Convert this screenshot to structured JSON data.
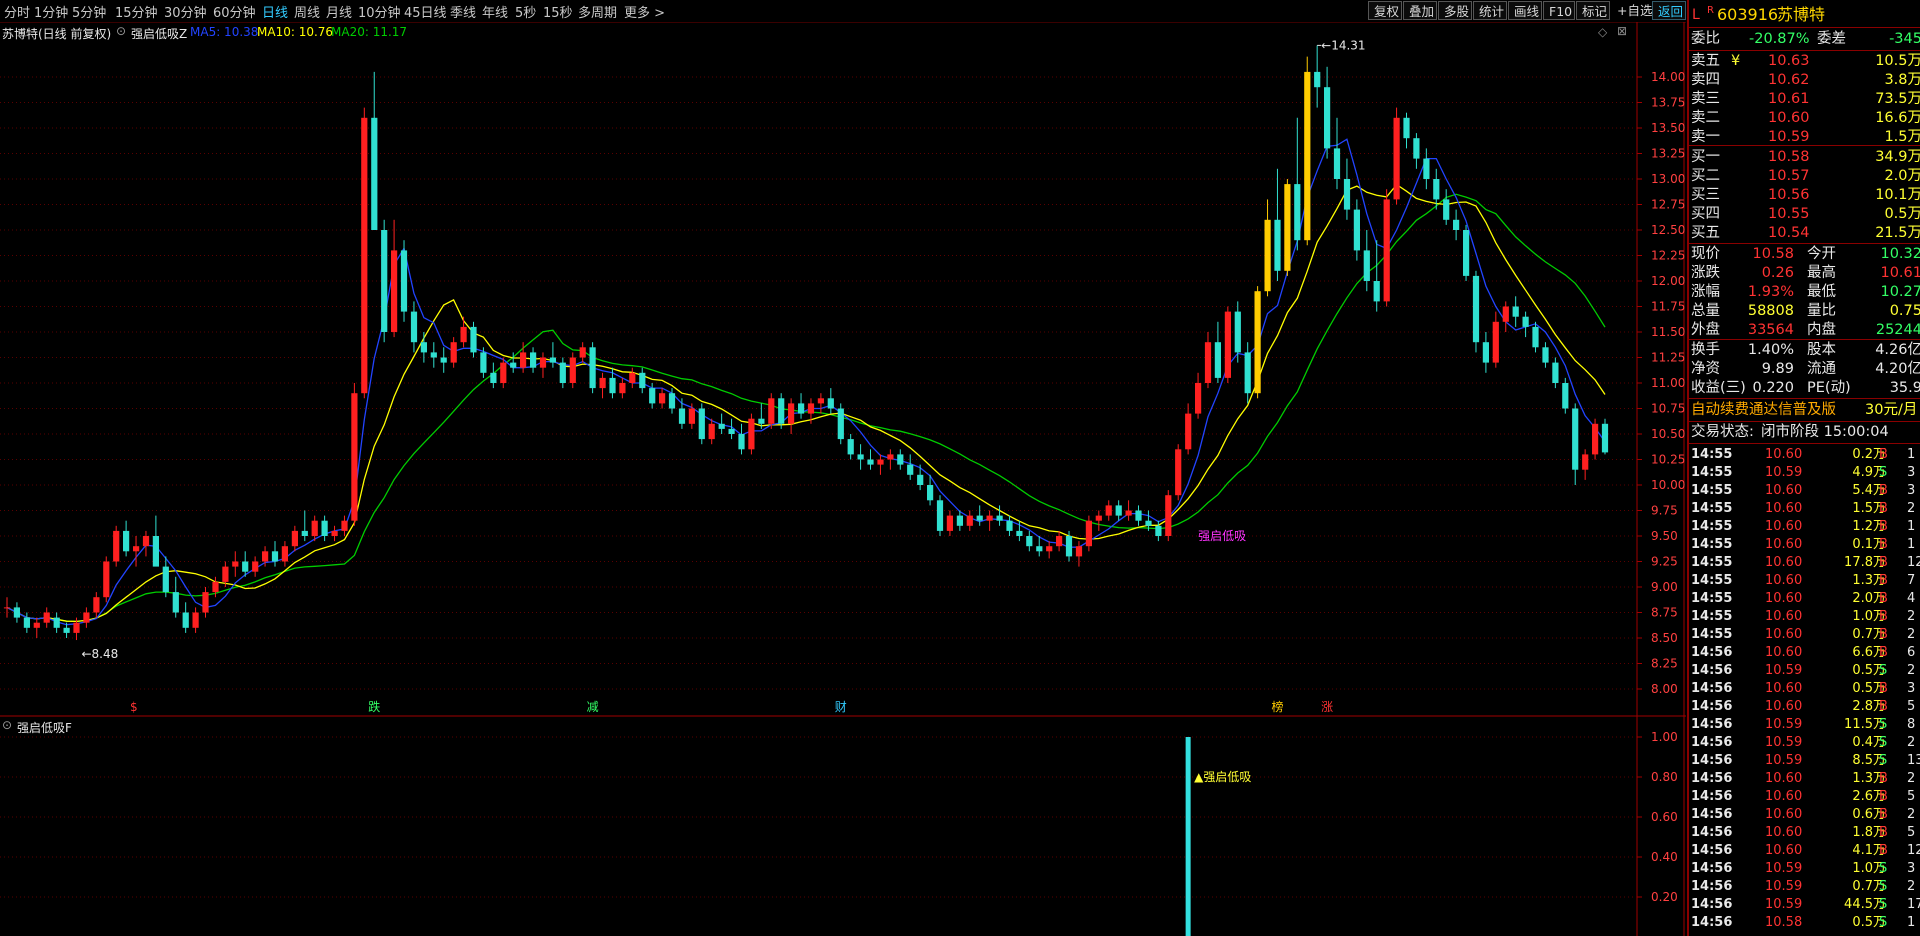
{
  "topbar": {
    "periods": [
      "分时",
      "1分钟",
      "5分钟",
      "15分钟",
      "30分钟",
      "60分钟",
      "日线",
      "周线",
      "月线",
      "10分钟",
      "45日线",
      "季线",
      "年线",
      "5秒",
      "15秒",
      "多周期",
      "更多 >"
    ],
    "active_period": "日线",
    "right_buttons": [
      "复权",
      "叠加",
      "多股",
      "统计",
      "画线",
      "F10",
      "标记",
      "+自选",
      "返回"
    ]
  },
  "chart_info": {
    "stock_desc": "苏博特(日线 前复权)",
    "indicator": "强启低吸Z",
    "ma5_label": "MA5: 10.38",
    "ma10_label": "MA10: 10.76",
    "ma20_label": "MA20: 11.17",
    "ma5_color": "#2244ff",
    "ma10_color": "#ffff00",
    "ma20_color": "#00cc00"
  },
  "sub_panel": {
    "title": "强启低吸F",
    "signal_label": "▲强启低吸"
  },
  "chart_data": {
    "type": "candlestick",
    "price_axis": [
      "14.00",
      "13.75",
      "13.50",
      "13.25",
      "13.00",
      "12.75",
      "12.50",
      "12.25",
      "12.00",
      "11.75",
      "11.50",
      "11.25",
      "11.00",
      "10.75",
      "10.50",
      "10.25",
      "10.00",
      "9.75",
      "9.50",
      "9.25",
      "9.00",
      "8.75",
      "8.50",
      "8.25",
      "8.00"
    ],
    "ylim": [
      7.88,
      14.42
    ],
    "sub_axis": [
      "1.00",
      "0.80",
      "0.60",
      "0.40",
      "0.20"
    ],
    "sub_ylim": [
      0,
      1.05
    ],
    "high_label": "14.31",
    "high_value": 14.31,
    "low_label": "8.48",
    "low_value": 8.48,
    "main_signal_label": "强启低吸",
    "event_markers": [
      {
        "text": "$",
        "color": "#ff3333",
        "idx": 13
      },
      {
        "text": "跌",
        "color": "#33ff66",
        "idx": 37
      },
      {
        "text": "减",
        "color": "#33ff66",
        "idx": 59
      },
      {
        "text": "财",
        "color": "#33ccff",
        "idx": 84
      },
      {
        "text": "榜",
        "color": "#ffcc00",
        "idx": 128
      },
      {
        "text": "涨",
        "color": "#ff3333",
        "idx": 133
      }
    ],
    "signal_idx": 119,
    "signal_value": 1.0,
    "candles": [
      [
        8.8,
        8.9,
        8.7,
        8.8
      ],
      [
        8.8,
        8.85,
        8.65,
        8.7
      ],
      [
        8.7,
        8.75,
        8.55,
        8.6
      ],
      [
        8.6,
        8.7,
        8.5,
        8.65
      ],
      [
        8.65,
        8.8,
        8.6,
        8.75
      ],
      [
        8.7,
        8.75,
        8.55,
        8.6
      ],
      [
        8.6,
        8.65,
        8.5,
        8.55
      ],
      [
        8.55,
        8.7,
        8.48,
        8.65
      ],
      [
        8.65,
        8.8,
        8.6,
        8.75
      ],
      [
        8.75,
        8.95,
        8.7,
        8.9
      ],
      [
        8.9,
        9.3,
        8.85,
        9.25
      ],
      [
        9.25,
        9.6,
        9.2,
        9.55
      ],
      [
        9.55,
        9.65,
        9.3,
        9.35
      ],
      [
        9.35,
        9.5,
        9.2,
        9.4
      ],
      [
        9.4,
        9.55,
        9.3,
        9.5
      ],
      [
        9.5,
        9.7,
        9.3,
        9.2
      ],
      [
        9.2,
        9.3,
        8.9,
        8.95
      ],
      [
        8.95,
        9.1,
        8.7,
        8.75
      ],
      [
        8.75,
        8.85,
        8.55,
        8.6
      ],
      [
        8.6,
        8.8,
        8.55,
        8.75
      ],
      [
        8.75,
        9.0,
        8.7,
        8.95
      ],
      [
        8.95,
        9.1,
        8.9,
        9.05
      ],
      [
        9.05,
        9.25,
        9.0,
        9.2
      ],
      [
        9.2,
        9.35,
        9.1,
        9.25
      ],
      [
        9.25,
        9.35,
        9.1,
        9.15
      ],
      [
        9.15,
        9.3,
        9.1,
        9.25
      ],
      [
        9.25,
        9.4,
        9.2,
        9.35
      ],
      [
        9.35,
        9.45,
        9.2,
        9.25
      ],
      [
        9.25,
        9.45,
        9.2,
        9.4
      ],
      [
        9.4,
        9.6,
        9.35,
        9.55
      ],
      [
        9.55,
        9.75,
        9.45,
        9.5
      ],
      [
        9.5,
        9.7,
        9.45,
        9.65
      ],
      [
        9.65,
        9.7,
        9.45,
        9.5
      ],
      [
        9.5,
        9.6,
        9.45,
        9.55
      ],
      [
        9.55,
        9.7,
        9.5,
        9.65
      ],
      [
        9.65,
        11.0,
        9.6,
        10.9
      ],
      [
        10.9,
        13.7,
        10.85,
        13.6
      ],
      [
        13.6,
        14.05,
        12.5,
        12.5
      ],
      [
        12.5,
        12.6,
        11.4,
        11.5
      ],
      [
        11.5,
        12.6,
        11.45,
        12.3
      ],
      [
        12.3,
        12.4,
        11.6,
        11.7
      ],
      [
        11.7,
        11.8,
        11.3,
        11.4
      ],
      [
        11.4,
        11.5,
        11.2,
        11.3
      ],
      [
        11.3,
        11.4,
        11.15,
        11.25
      ],
      [
        11.25,
        11.35,
        11.1,
        11.2
      ],
      [
        11.2,
        11.45,
        11.15,
        11.4
      ],
      [
        11.4,
        11.65,
        11.35,
        11.55
      ],
      [
        11.55,
        11.6,
        11.25,
        11.3
      ],
      [
        11.3,
        11.35,
        11.05,
        11.1
      ],
      [
        11.1,
        11.2,
        10.95,
        11.0
      ],
      [
        11.0,
        11.25,
        10.95,
        11.2
      ],
      [
        11.2,
        11.3,
        11.1,
        11.15
      ],
      [
        11.15,
        11.4,
        11.1,
        11.3
      ],
      [
        11.3,
        11.35,
        11.1,
        11.15
      ],
      [
        11.15,
        11.3,
        11.05,
        11.25
      ],
      [
        11.25,
        11.4,
        11.15,
        11.2
      ],
      [
        11.2,
        11.25,
        10.95,
        11.0
      ],
      [
        11.0,
        11.3,
        10.95,
        11.25
      ],
      [
        11.25,
        11.4,
        11.2,
        11.35
      ],
      [
        11.35,
        11.4,
        10.9,
        10.95
      ],
      [
        10.95,
        11.1,
        10.85,
        11.05
      ],
      [
        11.05,
        11.15,
        10.85,
        10.9
      ],
      [
        10.9,
        11.05,
        10.85,
        11.0
      ],
      [
        11.0,
        11.15,
        10.95,
        11.1
      ],
      [
        11.1,
        11.15,
        10.9,
        10.95
      ],
      [
        10.95,
        11.0,
        10.75,
        10.8
      ],
      [
        10.8,
        10.95,
        10.75,
        10.9
      ],
      [
        10.9,
        10.95,
        10.7,
        10.75
      ],
      [
        10.75,
        10.85,
        10.55,
        10.6
      ],
      [
        10.6,
        10.8,
        10.55,
        10.75
      ],
      [
        10.75,
        10.8,
        10.4,
        10.45
      ],
      [
        10.45,
        10.65,
        10.4,
        10.6
      ],
      [
        10.6,
        10.7,
        10.5,
        10.55
      ],
      [
        10.55,
        10.65,
        10.45,
        10.5
      ],
      [
        10.5,
        10.6,
        10.3,
        10.35
      ],
      [
        10.35,
        10.7,
        10.3,
        10.65
      ],
      [
        10.65,
        10.8,
        10.55,
        10.6
      ],
      [
        10.6,
        10.9,
        10.55,
        10.85
      ],
      [
        10.85,
        10.9,
        10.55,
        10.6
      ],
      [
        10.6,
        10.85,
        10.5,
        10.8
      ],
      [
        10.8,
        10.9,
        10.65,
        10.7
      ],
      [
        10.7,
        10.85,
        10.6,
        10.8
      ],
      [
        10.8,
        10.9,
        10.7,
        10.85
      ],
      [
        10.85,
        10.95,
        10.7,
        10.75
      ],
      [
        10.75,
        10.8,
        10.4,
        10.45
      ],
      [
        10.45,
        10.5,
        10.25,
        10.3
      ],
      [
        10.3,
        10.4,
        10.15,
        10.25
      ],
      [
        10.25,
        10.35,
        10.15,
        10.2
      ],
      [
        10.2,
        10.3,
        10.1,
        10.25
      ],
      [
        10.25,
        10.35,
        10.15,
        10.3
      ],
      [
        10.3,
        10.35,
        10.15,
        10.2
      ],
      [
        10.2,
        10.3,
        10.05,
        10.1
      ],
      [
        10.1,
        10.2,
        9.95,
        10.0
      ],
      [
        10.0,
        10.1,
        9.8,
        9.85
      ],
      [
        9.85,
        9.9,
        9.5,
        9.55
      ],
      [
        9.55,
        9.75,
        9.5,
        9.7
      ],
      [
        9.7,
        9.75,
        9.55,
        9.6
      ],
      [
        9.6,
        9.75,
        9.55,
        9.7
      ],
      [
        9.7,
        9.8,
        9.6,
        9.65
      ],
      [
        9.65,
        9.75,
        9.55,
        9.7
      ],
      [
        9.7,
        9.8,
        9.6,
        9.65
      ],
      [
        9.65,
        9.7,
        9.5,
        9.55
      ],
      [
        9.55,
        9.65,
        9.45,
        9.5
      ],
      [
        9.5,
        9.55,
        9.35,
        9.4
      ],
      [
        9.4,
        9.5,
        9.3,
        9.35
      ],
      [
        9.35,
        9.45,
        9.28,
        9.4
      ],
      [
        9.4,
        9.55,
        9.35,
        9.5
      ],
      [
        9.5,
        9.55,
        9.25,
        9.3
      ],
      [
        9.3,
        9.45,
        9.2,
        9.4
      ],
      [
        9.4,
        9.7,
        9.35,
        9.65
      ],
      [
        9.65,
        9.75,
        9.55,
        9.7
      ],
      [
        9.7,
        9.85,
        9.65,
        9.8
      ],
      [
        9.8,
        9.85,
        9.65,
        9.7
      ],
      [
        9.7,
        9.85,
        9.65,
        9.75
      ],
      [
        9.75,
        9.8,
        9.6,
        9.65
      ],
      [
        9.65,
        9.75,
        9.55,
        9.6
      ],
      [
        9.6,
        9.65,
        9.45,
        9.5
      ],
      [
        9.5,
        9.95,
        9.45,
        9.9
      ],
      [
        9.9,
        10.4,
        9.85,
        10.35
      ],
      [
        10.35,
        10.8,
        10.3,
        10.7
      ],
      [
        10.7,
        11.1,
        10.65,
        11.0
      ],
      [
        11.0,
        11.5,
        10.95,
        11.4
      ],
      [
        11.4,
        11.6,
        11.0,
        11.05
      ],
      [
        11.05,
        11.75,
        11.0,
        11.7
      ],
      [
        11.7,
        11.8,
        11.2,
        11.3
      ],
      [
        11.3,
        11.4,
        10.8,
        10.9
      ],
      [
        10.9,
        11.95,
        10.85,
        11.9
      ],
      [
        11.9,
        12.8,
        11.85,
        12.6
      ],
      [
        12.6,
        13.1,
        12.0,
        12.1
      ],
      [
        12.1,
        13.0,
        12.05,
        12.95
      ],
      [
        12.95,
        13.6,
        12.3,
        12.4
      ],
      [
        12.4,
        14.2,
        12.35,
        14.05
      ],
      [
        14.05,
        14.31,
        13.7,
        13.9
      ],
      [
        13.9,
        14.1,
        13.2,
        13.3
      ],
      [
        13.3,
        13.6,
        12.9,
        13.0
      ],
      [
        13.0,
        13.2,
        12.6,
        12.7
      ],
      [
        12.7,
        12.8,
        12.2,
        12.3
      ],
      [
        12.3,
        12.5,
        11.9,
        12.0
      ],
      [
        12.0,
        12.4,
        11.7,
        11.8
      ],
      [
        11.8,
        12.9,
        11.75,
        12.8
      ],
      [
        12.8,
        13.7,
        12.75,
        13.6
      ],
      [
        13.6,
        13.65,
        13.3,
        13.4
      ],
      [
        13.4,
        13.45,
        13.1,
        13.2
      ],
      [
        13.2,
        13.3,
        12.9,
        13.0
      ],
      [
        13.0,
        13.1,
        12.7,
        12.8
      ],
      [
        12.8,
        12.9,
        12.55,
        12.6
      ],
      [
        12.6,
        12.7,
        12.4,
        12.5
      ],
      [
        12.5,
        12.55,
        12.0,
        12.05
      ],
      [
        12.05,
        12.1,
        11.3,
        11.4
      ],
      [
        11.4,
        11.5,
        11.1,
        11.2
      ],
      [
        11.2,
        11.7,
        11.15,
        11.6
      ],
      [
        11.6,
        11.8,
        11.5,
        11.75
      ],
      [
        11.75,
        11.85,
        11.55,
        11.65
      ],
      [
        11.65,
        11.7,
        11.45,
        11.55
      ],
      [
        11.55,
        11.6,
        11.3,
        11.35
      ],
      [
        11.35,
        11.4,
        11.15,
        11.2
      ],
      [
        11.2,
        11.25,
        10.95,
        11.0
      ],
      [
        11.0,
        11.05,
        10.7,
        10.75
      ],
      [
        10.75,
        10.8,
        10.0,
        10.15
      ],
      [
        10.15,
        10.35,
        10.05,
        10.3
      ],
      [
        10.3,
        10.65,
        10.25,
        10.6
      ],
      [
        10.6,
        10.65,
        10.3,
        10.32
      ]
    ]
  },
  "quote": {
    "market_tag": "L",
    "r_tag": "R",
    "code": "603916",
    "name": "苏博特",
    "weibi_label": "委比",
    "weibi_val": "-20.87%",
    "weicha_label": "委差",
    "weicha_val": "-345",
    "asks": [
      {
        "label": "卖五",
        "price": "10.63",
        "vol": "10.5万"
      },
      {
        "label": "卖四",
        "price": "10.62",
        "vol": "3.8万"
      },
      {
        "label": "卖三",
        "price": "10.61",
        "vol": "73.5万"
      },
      {
        "label": "卖二",
        "price": "10.60",
        "vol": "16.6万"
      },
      {
        "label": "卖一",
        "price": "10.59",
        "vol": "1.5万"
      }
    ],
    "ask_yen": "¥",
    "bids": [
      {
        "label": "买一",
        "price": "10.58",
        "vol": "34.9万"
      },
      {
        "label": "买二",
        "price": "10.57",
        "vol": "2.0万"
      },
      {
        "label": "买三",
        "price": "10.56",
        "vol": "10.1万"
      },
      {
        "label": "买四",
        "price": "10.55",
        "vol": "0.5万"
      },
      {
        "label": "买五",
        "price": "10.54",
        "vol": "21.5万"
      }
    ],
    "stats1": [
      {
        "l1": "现价",
        "v1": "10.58",
        "c1": "red",
        "l2": "今开",
        "v2": "10.32",
        "c2": "grn"
      },
      {
        "l1": "涨跌",
        "v1": "0.26",
        "c1": "red",
        "l2": "最高",
        "v2": "10.61",
        "c2": "red"
      },
      {
        "l1": "涨幅",
        "v1": "1.93%",
        "c1": "red",
        "l2": "最低",
        "v2": "10.27",
        "c2": "grn"
      },
      {
        "l1": "总量",
        "v1": "58808",
        "c1": "yel",
        "l2": "量比",
        "v2": "0.75",
        "c2": "yel"
      },
      {
        "l1": "外盘",
        "v1": "33564",
        "c1": "red",
        "l2": "内盘",
        "v2": "25244",
        "c2": "grn"
      }
    ],
    "stats2": [
      {
        "l1": "换手",
        "v1": "1.40%",
        "l2": "股本",
        "v2": "4.26亿"
      },
      {
        "l1": "净资",
        "v1": "9.89",
        "l2": "流通",
        "v2": "4.20亿"
      },
      {
        "l1": "收益(三)",
        "v1": "0.220",
        "l2": "PE(动)",
        "v2": "35.9"
      }
    ],
    "promo_text": "自动续费通达信普及版",
    "promo_price": "30元/月",
    "status_label": "交易状态:",
    "status_value": "闭市阶段 15:00:04"
  },
  "ticks": [
    {
      "t": "14:55",
      "p": "10.60",
      "v": "0.2万",
      "d": "B",
      "n": "1"
    },
    {
      "t": "14:55",
      "p": "10.59",
      "v": "4.9万",
      "d": "S",
      "n": "3"
    },
    {
      "t": "14:55",
      "p": "10.60",
      "v": "5.4万",
      "d": "B",
      "n": "3"
    },
    {
      "t": "14:55",
      "p": "10.60",
      "v": "1.5万",
      "d": "B",
      "n": "2"
    },
    {
      "t": "14:55",
      "p": "10.60",
      "v": "1.2万",
      "d": "B",
      "n": "1"
    },
    {
      "t": "14:55",
      "p": "10.60",
      "v": "0.1万",
      "d": "B",
      "n": "1"
    },
    {
      "t": "14:55",
      "p": "10.60",
      "v": "17.8万",
      "d": "B",
      "n": "12"
    },
    {
      "t": "14:55",
      "p": "10.60",
      "v": "1.3万",
      "d": "B",
      "n": "7"
    },
    {
      "t": "14:55",
      "p": "10.60",
      "v": "2.0万",
      "d": "B",
      "n": "4"
    },
    {
      "t": "14:55",
      "p": "10.60",
      "v": "1.0万",
      "d": "B",
      "n": "2"
    },
    {
      "t": "14:55",
      "p": "10.60",
      "v": "0.7万",
      "d": "B",
      "n": "2"
    },
    {
      "t": "14:56",
      "p": "10.60",
      "v": "6.6万",
      "d": "B",
      "n": "6"
    },
    {
      "t": "14:56",
      "p": "10.59",
      "v": "0.5万",
      "d": "S",
      "n": "2"
    },
    {
      "t": "14:56",
      "p": "10.60",
      "v": "0.5万",
      "d": "B",
      "n": "3"
    },
    {
      "t": "14:56",
      "p": "10.60",
      "v": "2.8万",
      "d": "B",
      "n": "5"
    },
    {
      "t": "14:56",
      "p": "10.59",
      "v": "11.5万",
      "d": "S",
      "n": "8"
    },
    {
      "t": "14:56",
      "p": "10.59",
      "v": "0.4万",
      "d": "S",
      "n": "2"
    },
    {
      "t": "14:56",
      "p": "10.59",
      "v": "8.5万",
      "d": "S",
      "n": "13"
    },
    {
      "t": "14:56",
      "p": "10.60",
      "v": "1.3万",
      "d": "B",
      "n": "2"
    },
    {
      "t": "14:56",
      "p": "10.60",
      "v": "2.6万",
      "d": "B",
      "n": "5"
    },
    {
      "t": "14:56",
      "p": "10.60",
      "v": "0.6万",
      "d": "B",
      "n": "2"
    },
    {
      "t": "14:56",
      "p": "10.60",
      "v": "1.8万",
      "d": "B",
      "n": "5"
    },
    {
      "t": "14:56",
      "p": "10.60",
      "v": "4.1万",
      "d": "B",
      "n": "12"
    },
    {
      "t": "14:56",
      "p": "10.59",
      "v": "1.0万",
      "d": "S",
      "n": "3"
    },
    {
      "t": "14:56",
      "p": "10.59",
      "v": "0.7万",
      "d": "S",
      "n": "2"
    },
    {
      "t": "14:56",
      "p": "10.59",
      "v": "44.5万",
      "d": "S",
      "n": "17"
    },
    {
      "t": "14:56",
      "p": "10.58",
      "v": "0.5万",
      "d": "S",
      "n": "1"
    }
  ]
}
